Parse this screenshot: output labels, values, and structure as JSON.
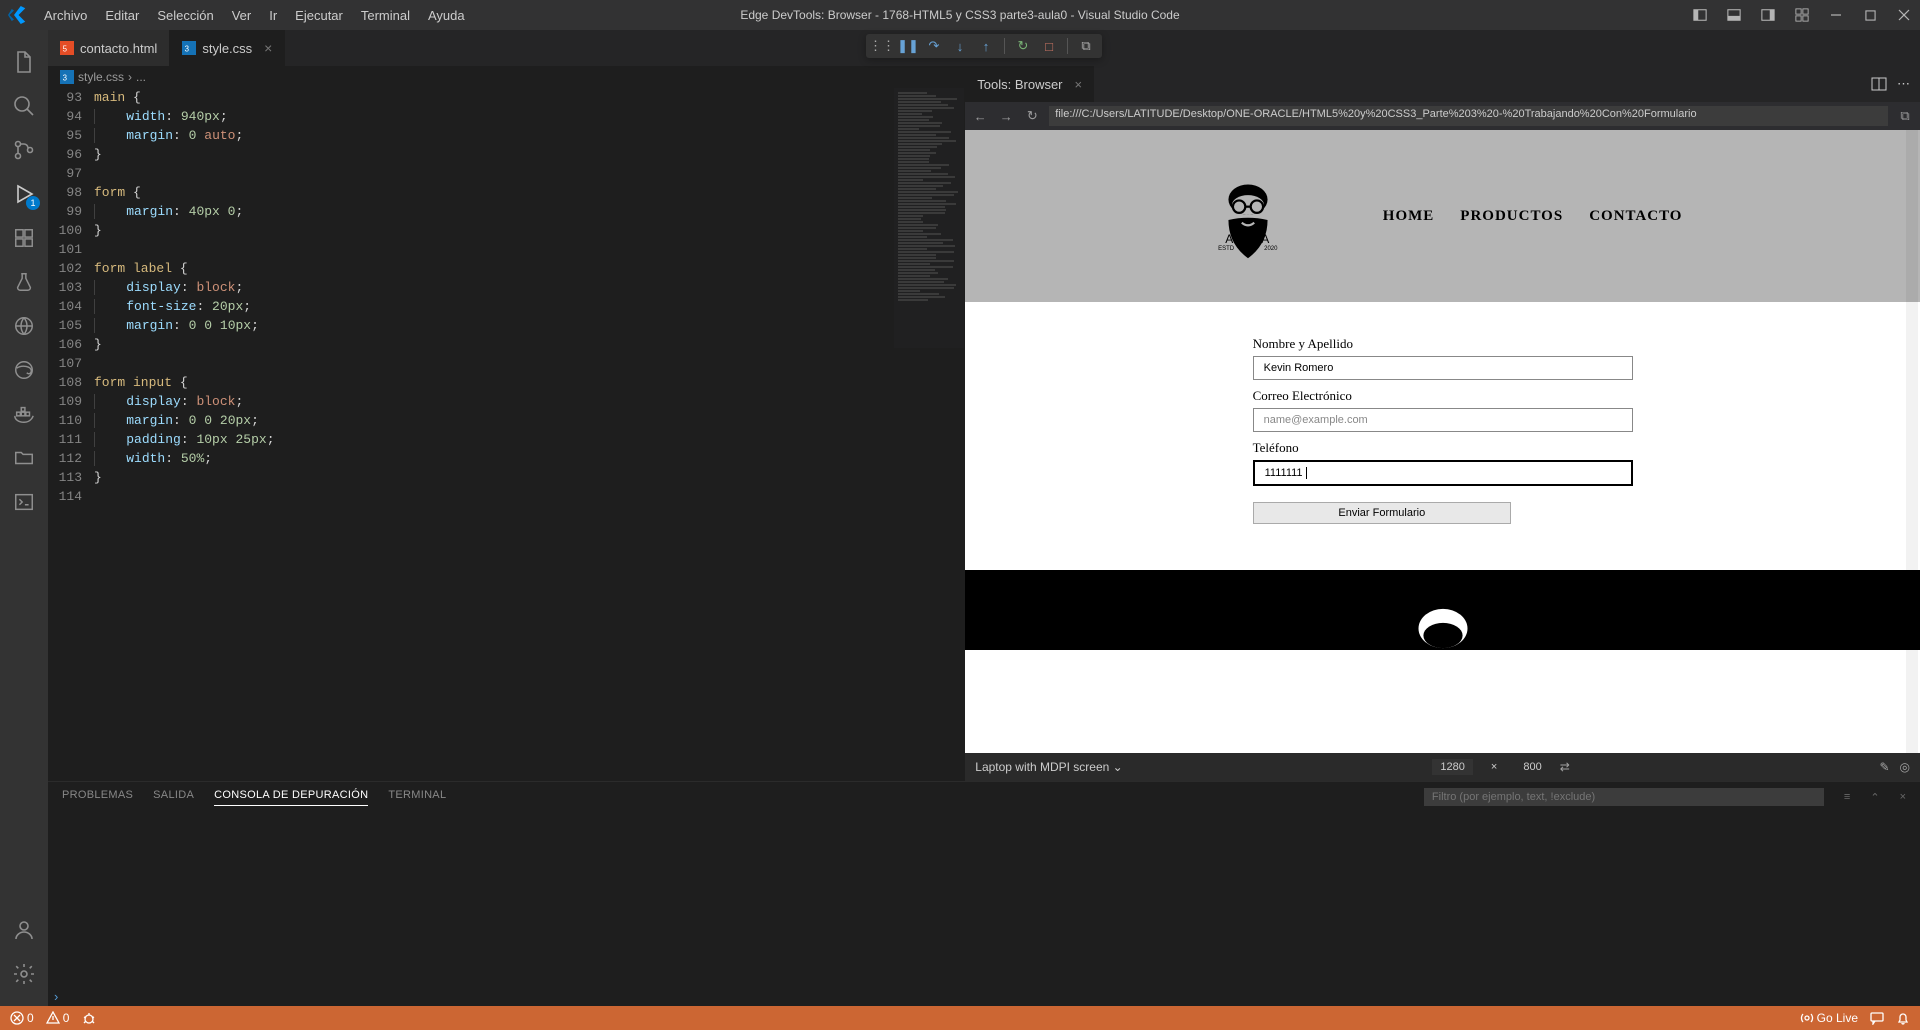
{
  "titlebar": {
    "menus": [
      "Archivo",
      "Editar",
      "Selección",
      "Ver",
      "Ir",
      "Ejecutar",
      "Terminal",
      "Ayuda"
    ],
    "title": "Edge DevTools: Browser - 1768-HTML5 y CSS3 parte3-aula0 - Visual Studio Code"
  },
  "tabs": {
    "left": [
      {
        "name": "contacto.html",
        "type": "html",
        "active": false
      },
      {
        "name": "style.css",
        "type": "css",
        "active": true
      }
    ],
    "right": {
      "name": "Tools: Browser"
    }
  },
  "breadcrumb": {
    "file": "style.css",
    "sep": "›",
    "rest": "..."
  },
  "code": {
    "startLine": 93,
    "lines": [
      [
        {
          "i": 0
        },
        {
          "t": "main",
          "c": "s-sel"
        },
        {
          "t": " "
        },
        {
          "t": "{",
          "c": "s-brace"
        }
      ],
      [
        {
          "i": 1
        },
        {
          "t": "width",
          "c": "s-prop"
        },
        {
          "t": ": ",
          "c": "s-punc"
        },
        {
          "t": "940px",
          "c": "s-num"
        },
        {
          "t": ";",
          "c": "s-punc"
        }
      ],
      [
        {
          "i": 1
        },
        {
          "t": "margin",
          "c": "s-prop"
        },
        {
          "t": ": ",
          "c": "s-punc"
        },
        {
          "t": "0",
          "c": "s-num"
        },
        {
          "t": " "
        },
        {
          "t": "auto",
          "c": "s-val"
        },
        {
          "t": ";",
          "c": "s-punc"
        }
      ],
      [
        {
          "i": 0
        },
        {
          "t": "}",
          "c": "s-brace"
        }
      ],
      [],
      [
        {
          "i": 0
        },
        {
          "t": "form",
          "c": "s-sel"
        },
        {
          "t": " "
        },
        {
          "t": "{",
          "c": "s-brace"
        }
      ],
      [
        {
          "i": 1
        },
        {
          "t": "margin",
          "c": "s-prop"
        },
        {
          "t": ": ",
          "c": "s-punc"
        },
        {
          "t": "40px",
          "c": "s-num"
        },
        {
          "t": " "
        },
        {
          "t": "0",
          "c": "s-num"
        },
        {
          "t": ";",
          "c": "s-punc"
        }
      ],
      [
        {
          "i": 0
        },
        {
          "t": "}",
          "c": "s-brace"
        }
      ],
      [],
      [
        {
          "i": 0
        },
        {
          "t": "form label",
          "c": "s-sel"
        },
        {
          "t": " "
        },
        {
          "t": "{",
          "c": "s-brace"
        }
      ],
      [
        {
          "i": 1
        },
        {
          "t": "display",
          "c": "s-prop"
        },
        {
          "t": ": ",
          "c": "s-punc"
        },
        {
          "t": "block",
          "c": "s-val"
        },
        {
          "t": ";",
          "c": "s-punc"
        }
      ],
      [
        {
          "i": 1
        },
        {
          "t": "font-size",
          "c": "s-prop"
        },
        {
          "t": ": ",
          "c": "s-punc"
        },
        {
          "t": "20px",
          "c": "s-num"
        },
        {
          "t": ";",
          "c": "s-punc"
        }
      ],
      [
        {
          "i": 1
        },
        {
          "t": "margin",
          "c": "s-prop"
        },
        {
          "t": ": ",
          "c": "s-punc"
        },
        {
          "t": "0",
          "c": "s-num"
        },
        {
          "t": " "
        },
        {
          "t": "0",
          "c": "s-num"
        },
        {
          "t": " "
        },
        {
          "t": "10px",
          "c": "s-num"
        },
        {
          "t": ";",
          "c": "s-punc"
        }
      ],
      [
        {
          "i": 0
        },
        {
          "t": "}",
          "c": "s-brace"
        }
      ],
      [],
      [
        {
          "i": 0
        },
        {
          "t": "form input",
          "c": "s-sel"
        },
        {
          "t": " "
        },
        {
          "t": "{",
          "c": "s-brace"
        }
      ],
      [
        {
          "i": 1
        },
        {
          "t": "display",
          "c": "s-prop"
        },
        {
          "t": ": ",
          "c": "s-punc"
        },
        {
          "t": "block",
          "c": "s-val"
        },
        {
          "t": ";",
          "c": "s-punc"
        }
      ],
      [
        {
          "i": 1
        },
        {
          "t": "margin",
          "c": "s-prop"
        },
        {
          "t": ": ",
          "c": "s-punc"
        },
        {
          "t": "0",
          "c": "s-num"
        },
        {
          "t": " "
        },
        {
          "t": "0",
          "c": "s-num"
        },
        {
          "t": " "
        },
        {
          "t": "20px",
          "c": "s-num"
        },
        {
          "t": ";",
          "c": "s-punc"
        }
      ],
      [
        {
          "i": 1
        },
        {
          "t": "padding",
          "c": "s-prop"
        },
        {
          "t": ": ",
          "c": "s-punc"
        },
        {
          "t": "10px",
          "c": "s-num"
        },
        {
          "t": " "
        },
        {
          "t": "25px",
          "c": "s-num"
        },
        {
          "t": ";",
          "c": "s-punc"
        }
      ],
      [
        {
          "i": 1
        },
        {
          "t": "width",
          "c": "s-prop"
        },
        {
          "t": ": ",
          "c": "s-punc"
        },
        {
          "t": "50%",
          "c": "s-num"
        },
        {
          "t": ";",
          "c": "s-punc"
        }
      ],
      [
        {
          "i": 0
        },
        {
          "t": "}",
          "c": "s-brace"
        }
      ],
      []
    ]
  },
  "browser": {
    "url": "file:///C:/Users/LATITUDE/Desktop/ONE-ORACLE/HTML5%20y%20CSS3_Parte%203%20-%20Trabajando%20Con%20Formulario"
  },
  "preview": {
    "nav": [
      "HOME",
      "PRODUCTOS",
      "CONTACTO"
    ],
    "logo": "ALURA",
    "logo_sub_left": "ESTD",
    "logo_sub_right": "2020",
    "labels": {
      "name": "Nombre y Apellido",
      "email": "Correo Electrónico",
      "phone": "Teléfono"
    },
    "values": {
      "name": "Kevin Romero",
      "email": "name@example.com",
      "phone": "1111111"
    },
    "submit": "Enviar Formulario"
  },
  "device": {
    "name": "Laptop with MDPI screen",
    "w": "1280",
    "x": "×",
    "h": "800"
  },
  "panel": {
    "tabs": [
      "PROBLEMAS",
      "SALIDA",
      "CONSOLA DE DEPURACIÓN",
      "TERMINAL"
    ],
    "activeIndex": 2,
    "filter_ph": "Filtro (por ejemplo, text, !exclude)"
  },
  "status": {
    "errors": "0",
    "warnings": "0",
    "golive": "Go Live"
  },
  "debug_badge": "1"
}
